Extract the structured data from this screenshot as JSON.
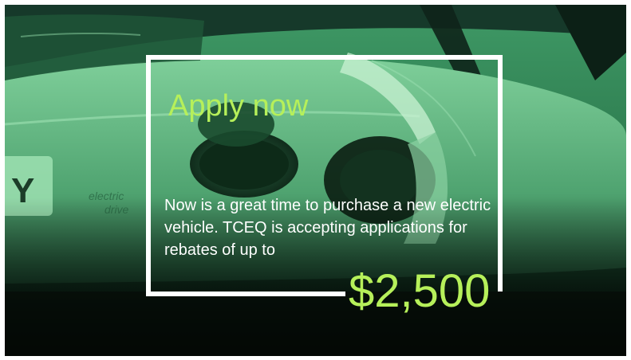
{
  "slide": {
    "headline": "Apply now",
    "body": "Now is a great time to purchase a new electric vehicle. TCEQ is accepting applications for rebates of up to",
    "amount": "$2,500",
    "background_image": "electric-vehicle-charging-photo",
    "colors": {
      "accent": "#b6f05a",
      "tint": "#2f8a55",
      "text": "#ffffff",
      "frame": "#ffffff"
    }
  }
}
